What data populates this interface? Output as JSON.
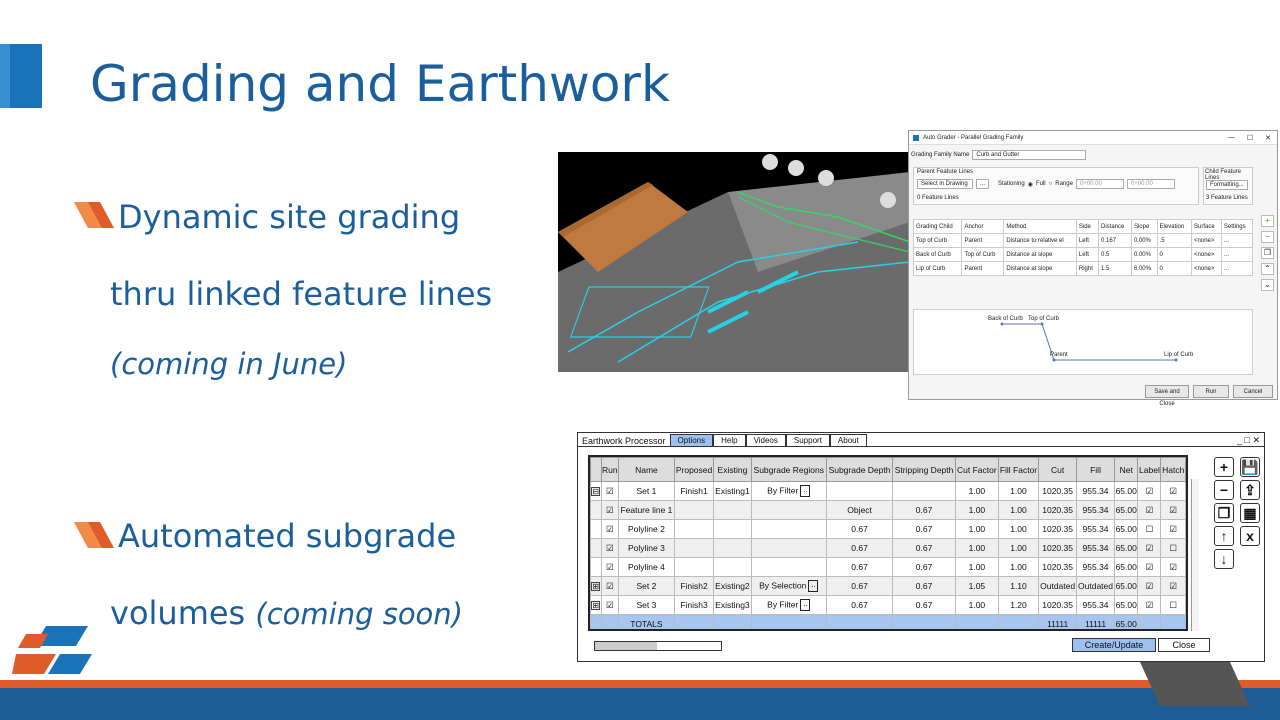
{
  "slide": {
    "title": "Grading and Earthwork",
    "bullets": [
      {
        "line1": "Dynamic site grading",
        "line2": "thru linked feature lines",
        "line3": "(coming in June)"
      },
      {
        "line1": "Automated subgrade",
        "line2a": "volumes ",
        "line2b": "(coming soon)"
      }
    ],
    "colors": {
      "title": "#1b5e9c",
      "accent_orange": "#e05b2a",
      "band_blue": "#1f5b94"
    }
  },
  "auto_grader": {
    "window_title": "Auto Grader - Parallel Grading Family",
    "window_controls": [
      "—",
      "☐",
      "✕"
    ],
    "family_name_label": "Grading Family Name",
    "family_name_value": "Curb and Gutter",
    "parent_group_label": "Parent Feature Lines",
    "select_label": "Select in Drawing",
    "stationing_label": "Stationing",
    "full_label": "Full",
    "range_label": "Range",
    "range_start": "0+00.00",
    "range_end": "0+00.00",
    "parent_count": "0 Feature Lines",
    "child_group_label": "Child Feature Lines",
    "formatting_label": "Formatting...",
    "child_count": "3 Feature Lines",
    "columns": [
      "Grading Child",
      "Anchor",
      "Method",
      "Side",
      "Distance",
      "Slope",
      "Elevation",
      "Surface",
      "Settings"
    ],
    "rows": [
      {
        "child": "Top of Curb",
        "anchor": "Parent",
        "method": "Distance to relative el",
        "side": "Left",
        "distance": "0.167",
        "slope": "0.00%",
        "elevation": ".5",
        "surface": "<none>",
        "settings": "..."
      },
      {
        "child": "Back of Curb",
        "anchor": "Top of Curb",
        "method": "Distance at slope",
        "side": "Left",
        "distance": "0.5",
        "slope": "0.00%",
        "elevation": "0",
        "surface": "<none>",
        "settings": "..."
      },
      {
        "child": "Lip of Curb",
        "anchor": "Parent",
        "method": "Distance at slope",
        "side": "Right",
        "distance": "1.5",
        "slope": "6.00%",
        "elevation": "0",
        "surface": "<none>",
        "settings": "..."
      }
    ],
    "profile_labels": [
      "Back of Curb",
      "Top of Curb",
      "Parent",
      "Lip of Curb"
    ],
    "buttons": {
      "save_close": "Save and Close",
      "run": "Run",
      "cancel": "Cancel"
    }
  },
  "earthwork": {
    "app_name": "Earthwork Processor",
    "tabs": [
      {
        "label": "Options",
        "active": true
      },
      {
        "label": "Help",
        "active": false
      },
      {
        "label": "Videos",
        "active": false
      },
      {
        "label": "Support",
        "active": false
      },
      {
        "label": "About",
        "active": false
      }
    ],
    "window_buttons": "_ □ ✕",
    "columns": [
      "",
      "Run",
      "Name",
      "Proposed",
      "Existing",
      "Subgrade Regions",
      "Subgrade Depth",
      "Stripping Depth",
      "Cut Factor",
      "Fill Factor",
      "Cut",
      "Fill",
      "Net",
      "Label",
      "Hatch"
    ],
    "rows": [
      {
        "expand": "⊟",
        "run": "☑",
        "name": "Set 1",
        "proposed": "Finish1",
        "existing": "Existing1",
        "regions": "By Filter",
        "regions_btn": true,
        "sub_depth": "",
        "strip": "",
        "cut_f": "1.00",
        "fill_f": "1.00",
        "cut": "1020.35",
        "fill": "955.34",
        "net": "65.00",
        "label": "☑",
        "hatch": "☑"
      },
      {
        "expand": "",
        "run": "☑",
        "name": "Feature line 1",
        "proposed": "",
        "existing": "",
        "regions": "",
        "regions_btn": false,
        "sub_depth": "Object",
        "strip": "0.67",
        "cut_f": "1.00",
        "fill_f": "1.00",
        "cut": "1020.35",
        "fill": "955.34",
        "net": "65.00",
        "label": "☑",
        "hatch": "☑"
      },
      {
        "expand": "",
        "run": "☑",
        "name": "Polyline 2",
        "proposed": "",
        "existing": "",
        "regions": "",
        "regions_btn": false,
        "sub_depth": "0.67",
        "strip": "0.67",
        "cut_f": "1.00",
        "fill_f": "1.00",
        "cut": "1020.35",
        "fill": "955.34",
        "net": "65.00",
        "label": "☐",
        "hatch": "☑"
      },
      {
        "expand": "",
        "run": "☑",
        "name": "Polyline 3",
        "proposed": "",
        "existing": "",
        "regions": "",
        "regions_btn": false,
        "sub_depth": "0.67",
        "strip": "0.67",
        "cut_f": "1.00",
        "fill_f": "1.00",
        "cut": "1020.35",
        "fill": "955.34",
        "net": "65.00",
        "label": "☑",
        "hatch": "☐"
      },
      {
        "expand": "",
        "run": "☑",
        "name": "Polyline 4",
        "proposed": "",
        "existing": "",
        "regions": "",
        "regions_btn": false,
        "sub_depth": "0.67",
        "strip": "0.67",
        "cut_f": "1.00",
        "fill_f": "1.00",
        "cut": "1020.35",
        "fill": "955.34",
        "net": "65.00",
        "label": "☑",
        "hatch": "☑"
      },
      {
        "expand": "⊞",
        "run": "☑",
        "name": "Set 2",
        "proposed": "Finish2",
        "existing": "Existing2",
        "regions": "By Selection",
        "regions_btn": true,
        "sub_depth": "0.67",
        "strip": "0.67",
        "cut_f": "1.05",
        "fill_f": "1.10",
        "cut": "Outdated",
        "fill": "Outdated",
        "net": "65.00",
        "label": "☑",
        "hatch": "☑"
      },
      {
        "expand": "⊞",
        "run": "☑",
        "name": "Set 3",
        "proposed": "Finish3",
        "existing": "Existing3",
        "regions": "By Filter",
        "regions_btn": true,
        "sub_depth": "0.67",
        "strip": "0.67",
        "cut_f": "1.00",
        "fill_f": "1.20",
        "cut": "1020.35",
        "fill": "955.34",
        "net": "65.00",
        "label": "☑",
        "hatch": "☐"
      }
    ],
    "totals": {
      "name": "TOTALS",
      "cut": "11111",
      "fill": "11111",
      "net": "65.00"
    },
    "tool_icons": [
      "+",
      "💾",
      "−",
      "⇪",
      "❐",
      "▦",
      "↑",
      "x",
      "↓"
    ],
    "buttons": {
      "create": "Create/Update",
      "close": "Close"
    }
  }
}
